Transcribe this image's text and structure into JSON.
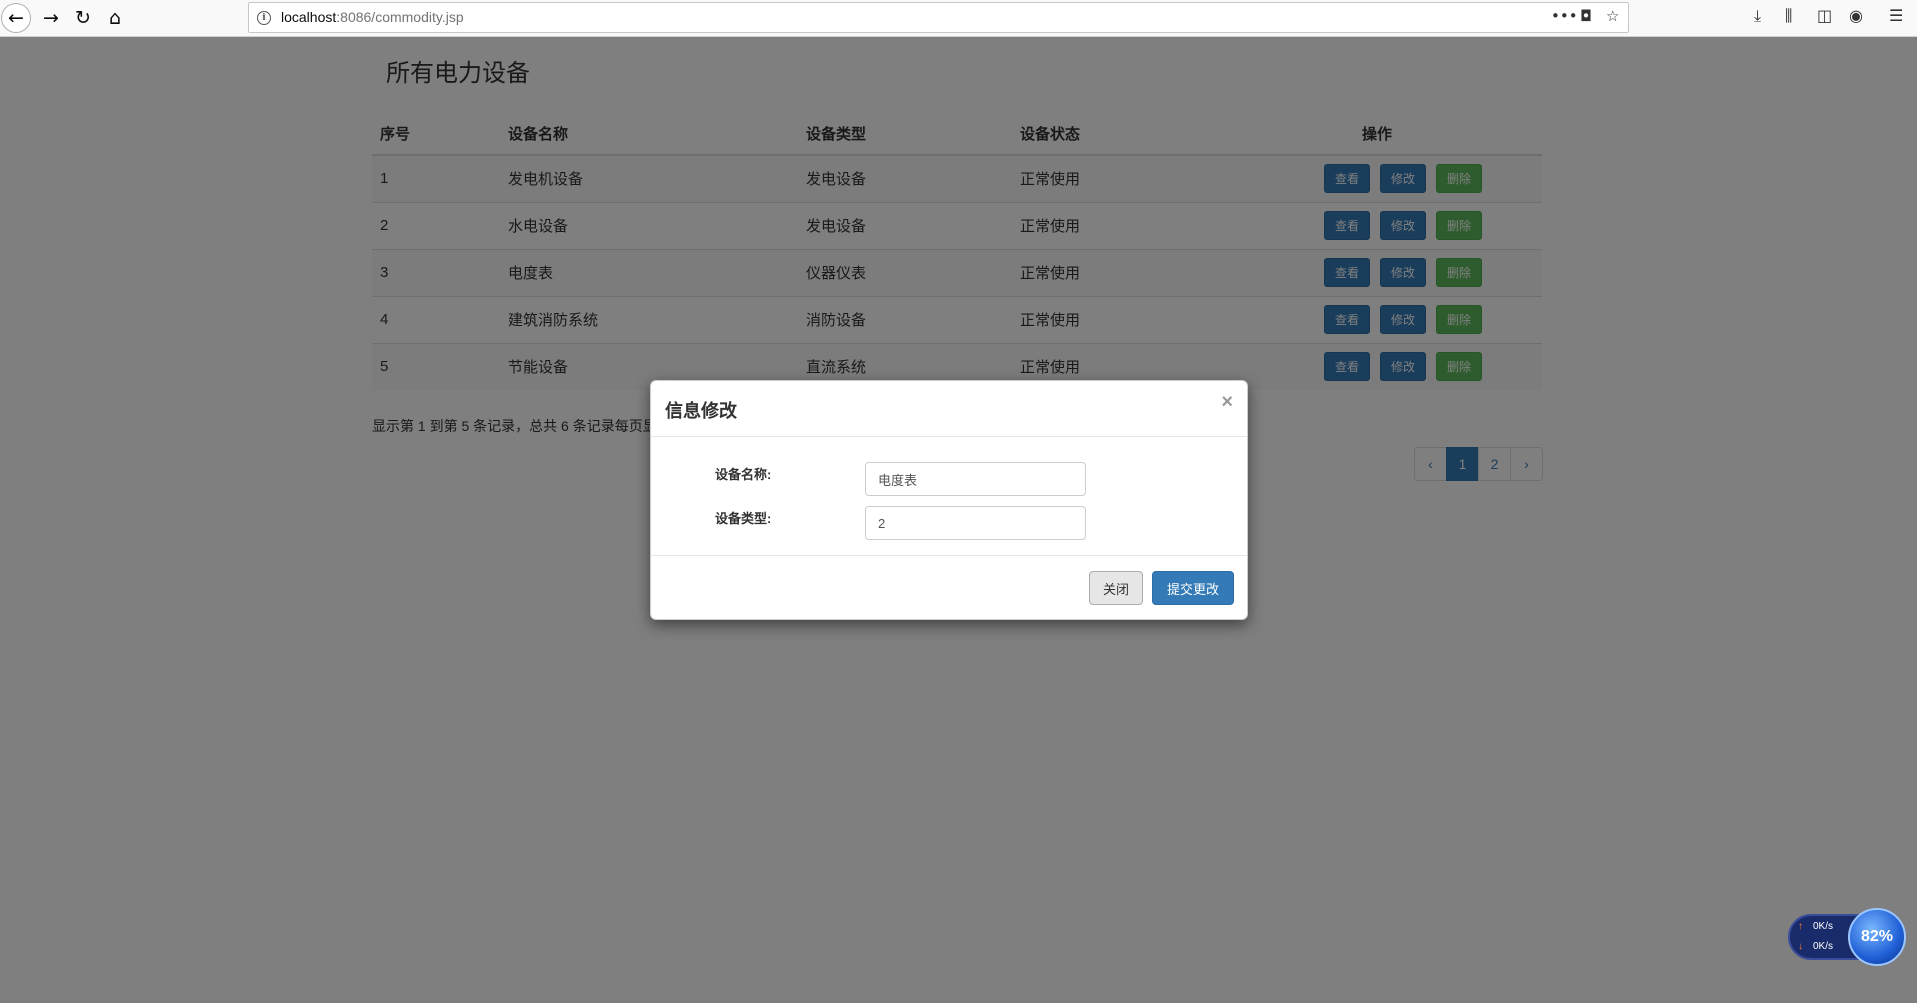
{
  "browser": {
    "url_host": "localhost",
    "url_path": ":8086/commodity.jsp"
  },
  "page": {
    "title": "所有电力设备",
    "columns": [
      "序号",
      "设备名称",
      "设备类型",
      "设备状态",
      "操作"
    ],
    "rows": [
      {
        "id": "1",
        "name": "发电机设备",
        "type": "发电设备",
        "status": "正常使用"
      },
      {
        "id": "2",
        "name": "水电设备",
        "type": "发电设备",
        "status": "正常使用"
      },
      {
        "id": "3",
        "name": "电度表",
        "type": "仪器仪表",
        "status": "正常使用"
      },
      {
        "id": "4",
        "name": "建筑消防系统",
        "type": "消防设备",
        "status": "正常使用"
      },
      {
        "id": "5",
        "name": "节能设备",
        "type": "直流系统",
        "status": "正常使用"
      }
    ],
    "actions": {
      "view": "查看",
      "edit": "修改",
      "delete": "删除"
    },
    "page_info": "显示第 1 到第 5 条记录，总共 6 条记录每页显",
    "pagination": {
      "prev": "‹",
      "pages": [
        "1",
        "2"
      ],
      "next": "›",
      "current": "1"
    }
  },
  "modal": {
    "title": "信息修改",
    "close": "×",
    "fields": [
      {
        "label": "设备名称:",
        "value": "电度表"
      },
      {
        "label": "设备类型:",
        "value": "2"
      }
    ],
    "close_button": "关闭",
    "submit_button": "提交更改"
  },
  "widget": {
    "upload": "0K/s",
    "download": "0K/s",
    "percent": "82%"
  }
}
